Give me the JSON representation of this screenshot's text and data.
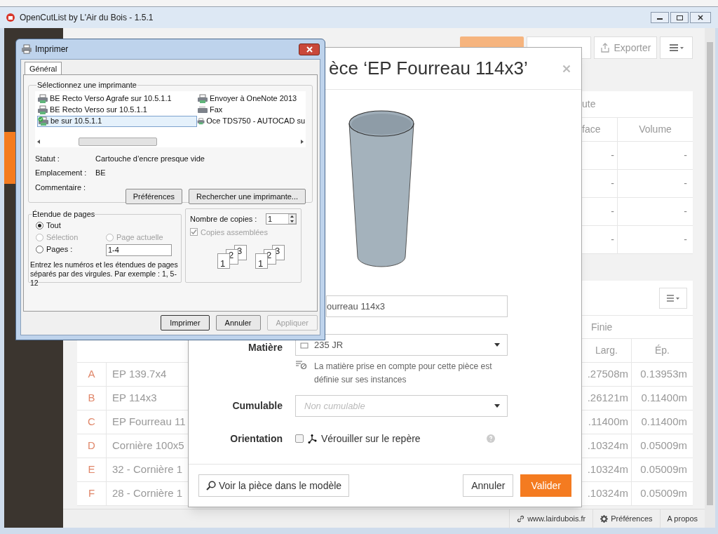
{
  "app_window": {
    "title": "OpenCutList by L'Air du Bois - 1.5.1"
  },
  "toolbar": {
    "generate_disabled": true,
    "export_label": "Exporter"
  },
  "upper_table": {
    "group_header": "ute",
    "columns": [
      "face",
      "Volume"
    ],
    "rows": [
      [
        "-",
        "-"
      ],
      [
        "-",
        "-"
      ],
      [
        "-",
        "-"
      ],
      [
        "-",
        "-"
      ]
    ]
  },
  "lower_table": {
    "group_header": "Finie",
    "columns": [
      "Larg.",
      "Ép."
    ],
    "rows": [
      {
        "letter": "A",
        "name": "EP 139.7x4",
        "width": ".27508m",
        "thickness": "0.13953m"
      },
      {
        "letter": "B",
        "name": "EP 114x3",
        "width": ".26121m",
        "thickness": "0.11400m"
      },
      {
        "letter": "C",
        "name": "EP Fourreau 11",
        "width": ".11400m",
        "thickness": "0.11400m"
      },
      {
        "letter": "D",
        "name": "Cornière 100x5",
        "width": ".10324m",
        "thickness": "0.05009m"
      },
      {
        "letter": "E",
        "name": "32 - Cornière 1",
        "width": ".10324m",
        "thickness": "0.05009m"
      },
      {
        "letter": "F",
        "name": "28 - Cornière 1",
        "width": ".10324m",
        "thickness": "0.05009m"
      }
    ]
  },
  "footer_bar": {
    "items": [
      {
        "kind": "link",
        "label": "www.lairdubois.fr"
      },
      {
        "kind": "settings",
        "label": "Préférences"
      },
      {
        "kind": "plain",
        "label": "A propos"
      }
    ]
  },
  "part_modal": {
    "title": "èce ‘EP Fourreau 114x3’",
    "name_value": "ourreau 114x3",
    "material_label": "Matière",
    "material_value": "235 JR",
    "material_note": "La matière prise en compte pour cette pièce est définie sur ses instances",
    "cumulable_label": "Cumulable",
    "cumulable_placeholder": "Non cumulable",
    "orientation_label": "Orientation",
    "orientation_checkbox": {
      "label": "Vérouiller sur le repère",
      "checked": false
    },
    "view_button": "Voir la pièce dans le modèle",
    "cancel_button": "Annuler",
    "confirm_button": "Valider"
  },
  "print_dialog": {
    "title": "Imprimer",
    "tabs": [
      {
        "label": "Général",
        "selected": true
      }
    ],
    "printer_group": "Sélectionnez une imprimante",
    "printers": [
      {
        "name": "BE Recto Verso Agrafe sur 10.5.1.1",
        "kind": "printer",
        "selected": false,
        "default": false
      },
      {
        "name": "BE Recto Verso sur 10.5.1.1",
        "kind": "printer",
        "selected": false,
        "default": false
      },
      {
        "name": "be sur 10.5.1.1",
        "kind": "printer",
        "selected": true,
        "default": true
      },
      {
        "name": "Envoyer à OneNote 2013",
        "kind": "printer",
        "selected": false,
        "default": false
      },
      {
        "name": "Fax",
        "kind": "fax",
        "selected": false,
        "default": false
      },
      {
        "name": "Oce TDS750 - AUTOCAD su",
        "kind": "printer",
        "selected": false,
        "default": false
      }
    ],
    "info": [
      {
        "label": "Statut :",
        "value": "Cartouche d’encre presque vide"
      },
      {
        "label": "Emplacement :",
        "value": "BE"
      },
      {
        "label": "Commentaire :"
      }
    ],
    "printer_buttons": [
      "Préférences",
      "Rechercher une imprimante..."
    ],
    "range_group": "Étendue de pages",
    "ranges": [
      {
        "label": "Tout",
        "selected": true,
        "disabled": false
      },
      {
        "label": "Sélection",
        "selected": false,
        "disabled": true
      },
      {
        "label": "Page actuelle",
        "selected": false,
        "disabled": true
      },
      {
        "label": "Pages :",
        "selected": false,
        "disabled": false
      }
    ],
    "pages_value": "1-4",
    "range_hint": "Entrez les numéros et les étendues de pages séparés par des virgules. Par exemple : 1, 5-12",
    "copies_label": "Nombre de copies :",
    "copies_value": "1",
    "collate": {
      "label": "Copies assemblées",
      "checked": true,
      "disabled": true
    },
    "collate_stacks": [
      [
        "1",
        "2",
        "3"
      ],
      [
        "1",
        "2",
        "3"
      ]
    ],
    "buttons": [
      {
        "label": "Imprimer",
        "disabled": false
      },
      {
        "label": "Annuler",
        "disabled": false
      },
      {
        "label": "Appliquer",
        "disabled": true
      }
    ]
  }
}
